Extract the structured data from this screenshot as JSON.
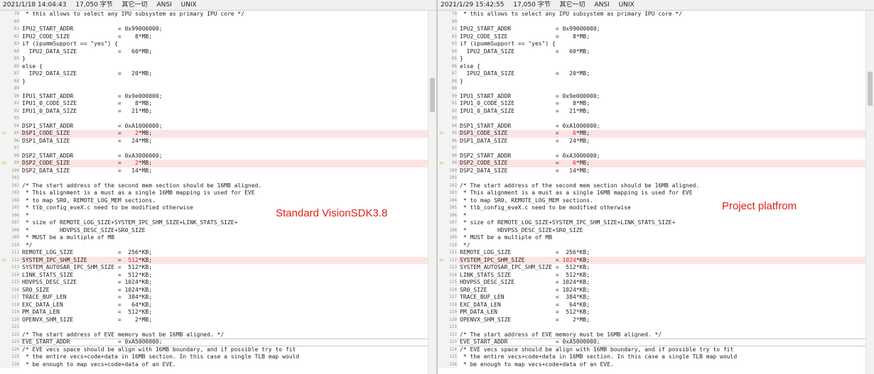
{
  "left": {
    "status": {
      "datetime": "2021/1/18 14:04:43",
      "size": "17,050 字节",
      "filter": "其它一切",
      "encoding": "ANSI",
      "eol": "UNIX"
    },
    "caption": "Standard VisionSDK3.8",
    "lines": [
      {
        "n": "79",
        "t": " * this allows to select any IPU subsystem as primary IPU core */"
      },
      {
        "n": "80",
        "t": ""
      },
      {
        "n": "81",
        "t": "IPU2_START_ADDR             = 0x99000000;"
      },
      {
        "n": "82",
        "t": "IPU2_CODE_SIZE              =    8*MB;"
      },
      {
        "n": "83",
        "t": "if (ipummSupport == \"yes\") {"
      },
      {
        "n": "84",
        "t": "  IPU2_DATA_SIZE            =   60*MB;"
      },
      {
        "n": "85",
        "t": "}"
      },
      {
        "n": "86",
        "t": "else {"
      },
      {
        "n": "87",
        "t": "  IPU2_DATA_SIZE            =   20*MB;"
      },
      {
        "n": "88",
        "t": "}"
      },
      {
        "n": "89",
        "t": ""
      },
      {
        "n": "90",
        "t": "IPU1_START_ADDR             = 0x9e000000;"
      },
      {
        "n": "91",
        "t": "IPU1_0_CODE_SIZE            =    8*MB;"
      },
      {
        "n": "92",
        "t": "IPU1_0_DATA_SIZE            =   21*MB;"
      },
      {
        "n": "93",
        "t": ""
      },
      {
        "n": "94",
        "t": "DSP1_START_ADDR             = 0xA1000000;"
      },
      {
        "n": "95",
        "p": "DSP1_CODE_SIZE              =    ",
        "h": "2",
        "s": "*MB;",
        "diff": true
      },
      {
        "n": "96",
        "t": "DSP1_DATA_SIZE              =   24*MB;"
      },
      {
        "n": "97",
        "t": ""
      },
      {
        "n": "98",
        "t": "DSP2_START_ADDR             = 0xA3000000;"
      },
      {
        "n": "99",
        "p": "DSP2_CODE_SIZE              =    ",
        "h": "2",
        "s": "*MB;",
        "diff": true
      },
      {
        "n": "100",
        "t": "DSP2_DATA_SIZE              =   14*MB;"
      },
      {
        "n": "101",
        "t": ""
      },
      {
        "n": "102",
        "t": "/* The start address of the second mem section should be 16MB aligned."
      },
      {
        "n": "103",
        "t": " * This alignment is a must as a single 16MB mapping is used for EVE"
      },
      {
        "n": "104",
        "t": " * to map SR0, REMOTE_LOG_MEM sections."
      },
      {
        "n": "105",
        "t": " * tlb_config_eveX.c need to be modified otherwise"
      },
      {
        "n": "106",
        "t": " *"
      },
      {
        "n": "107",
        "t": " * size of REMOTE_LOG_SIZE+SYSTEM_IPC_SHM_SIZE+LINK_STATS_SIZE+"
      },
      {
        "n": "108",
        "t": " *         HDVPSS_DESC_SIZE+SR0_SIZE"
      },
      {
        "n": "109",
        "t": " * MUST be a multiple of MB"
      },
      {
        "n": "110",
        "t": " */"
      },
      {
        "n": "111",
        "t": "REMOTE_LOG_SIZE             =  256*KB;"
      },
      {
        "n": "112",
        "p": "SYSTEM_IPC_SHM_SIZE         =  ",
        "h": "512",
        "s": "*KB;",
        "diff": true
      },
      {
        "n": "113",
        "t": "SYSTEM_AUTOSAR_IPC_SHM_SIZE =  512*KB;"
      },
      {
        "n": "114",
        "t": "LINK_STATS_SIZE             =  512*KB;"
      },
      {
        "n": "115",
        "t": "HDVPSS_DESC_SIZE            = 1024*KB;"
      },
      {
        "n": "116",
        "t": "SR0_SIZE                    = 1024*KB;"
      },
      {
        "n": "117",
        "t": "TRACE_BUF_LEN               =  384*KB;"
      },
      {
        "n": "118",
        "t": "EXC_DATA_LEN                =   64*KB;"
      },
      {
        "n": "119",
        "t": "PM_DATA_LEN                 =  512*KB;"
      },
      {
        "n": "120",
        "t": "OPENVX_SHM_SIZE             =    2*MB;"
      },
      {
        "n": "121",
        "t": ""
      },
      {
        "n": "122",
        "t": "/* The start address of EVE memory must be 16MB aligned. */"
      },
      {
        "n": "123",
        "t": "EVE_START_ADDR              = 0xA5000000;",
        "boxed": true
      },
      {
        "n": "124",
        "t": "/* EVE vecs space should be align with 16MB boundary, and if possible try to fit"
      },
      {
        "n": "125",
        "t": " * the entire vecs+code+data in 16MB section. In this case a single TLB map would"
      },
      {
        "n": "126",
        "t": " * be enough to map vecs+code+data of an EVE."
      }
    ]
  },
  "right": {
    "status": {
      "datetime": "2021/1/29 15:42:55",
      "size": "17,050 字节",
      "filter": "其它一切",
      "encoding": "ANSI",
      "eol": "UNIX"
    },
    "caption": "Project platfrom",
    "lines": [
      {
        "n": "79",
        "t": " * this allows to select any IPU subsystem as primary IPU core */"
      },
      {
        "n": "80",
        "t": ""
      },
      {
        "n": "81",
        "t": "IPU2_START_ADDR             = 0x99000000;"
      },
      {
        "n": "82",
        "t": "IPU2_CODE_SIZE              =    8*MB;"
      },
      {
        "n": "83",
        "t": "if (ipummSupport == \"yes\") {"
      },
      {
        "n": "84",
        "t": "  IPU2_DATA_SIZE            =   60*MB;"
      },
      {
        "n": "85",
        "t": "}"
      },
      {
        "n": "86",
        "t": "else {"
      },
      {
        "n": "87",
        "t": "  IPU2_DATA_SIZE            =   20*MB;"
      },
      {
        "n": "88",
        "t": "}"
      },
      {
        "n": "89",
        "t": ""
      },
      {
        "n": "90",
        "t": "IPU1_START_ADDR             = 0x9e000000;"
      },
      {
        "n": "91",
        "t": "IPU1_0_CODE_SIZE            =    8*MB;"
      },
      {
        "n": "92",
        "t": "IPU1_0_DATA_SIZE            =   21*MB;"
      },
      {
        "n": "93",
        "t": ""
      },
      {
        "n": "94",
        "t": "DSP1_START_ADDR             = 0xA1000000;"
      },
      {
        "n": "95",
        "p": "DSP1_CODE_SIZE              =    ",
        "h": "6",
        "s": "*MB;",
        "diff": true
      },
      {
        "n": "96",
        "t": "DSP1_DATA_SIZE              =   24*MB;"
      },
      {
        "n": "97",
        "t": ""
      },
      {
        "n": "98",
        "t": "DSP2_START_ADDR             = 0xA3000000;"
      },
      {
        "n": "99",
        "p": "DSP2_CODE_SIZE              =    ",
        "h": "6",
        "s": "*MB;",
        "diff": true
      },
      {
        "n": "100",
        "t": "DSP2_DATA_SIZE              =   14*MB;"
      },
      {
        "n": "101",
        "t": ""
      },
      {
        "n": "102",
        "t": "/* The start address of the second mem section should be 16MB aligned."
      },
      {
        "n": "103",
        "t": " * This alignment is a must as a single 16MB mapping is used for EVE"
      },
      {
        "n": "104",
        "t": " * to map SR0, REMOTE_LOG_MEM sections."
      },
      {
        "n": "105",
        "t": " * tlb_config_eveX.c need to be modified otherwise"
      },
      {
        "n": "106",
        "t": " *"
      },
      {
        "n": "107",
        "t": " * size of REMOTE_LOG_SIZE+SYSTEM_IPC_SHM_SIZE+LINK_STATS_SIZE+"
      },
      {
        "n": "108",
        "t": " *         HDVPSS_DESC_SIZE+SR0_SIZE"
      },
      {
        "n": "109",
        "t": " * MUST be a multiple of MB"
      },
      {
        "n": "110",
        "t": " */"
      },
      {
        "n": "111",
        "t": "REMOTE_LOG_SIZE             =  256*KB;"
      },
      {
        "n": "112",
        "p": "SYSTEM_IPC_SHM_SIZE         = ",
        "h": "1024",
        "s": "*KB;",
        "diff": true
      },
      {
        "n": "113",
        "t": "SYSTEM_AUTOSAR_IPC_SHM_SIZE =  512*KB;"
      },
      {
        "n": "114",
        "t": "LINK_STATS_SIZE             =  512*KB;"
      },
      {
        "n": "115",
        "t": "HDVPSS_DESC_SIZE            = 1024*KB;"
      },
      {
        "n": "116",
        "t": "SR0_SIZE                    = 1024*KB;"
      },
      {
        "n": "117",
        "t": "TRACE_BUF_LEN               =  384*KB;"
      },
      {
        "n": "118",
        "t": "EXC_DATA_LEN                =   64*KB;"
      },
      {
        "n": "119",
        "t": "PM_DATA_LEN                 =  512*KB;"
      },
      {
        "n": "120",
        "t": "OPENVX_SHM_SIZE             =    2*MB;"
      },
      {
        "n": "121",
        "t": ""
      },
      {
        "n": "122",
        "t": "/* The start address of EVE memory must be 16MB aligned. */"
      },
      {
        "n": "123",
        "t": "EVE_START_ADDR              = 0xA5000000;",
        "boxed": true
      },
      {
        "n": "124",
        "t": "/* EVE vecs space should be align with 16MB boundary, and if possible try to fit"
      },
      {
        "n": "125",
        "t": " * the entire vecs+code+data in 16MB section. In this case a single TLB map would"
      },
      {
        "n": "126",
        "t": " * be enough to map vecs+code+data of an EVE."
      }
    ]
  },
  "colors": {
    "diff_background": "#fde4e4",
    "changed_value": "#e02020",
    "arrow": "#d8a000",
    "caption": "#e0201a"
  },
  "icons": {
    "diff_marker": "arrow-right-icon (left pane), arrow-left-icon (right pane)"
  }
}
